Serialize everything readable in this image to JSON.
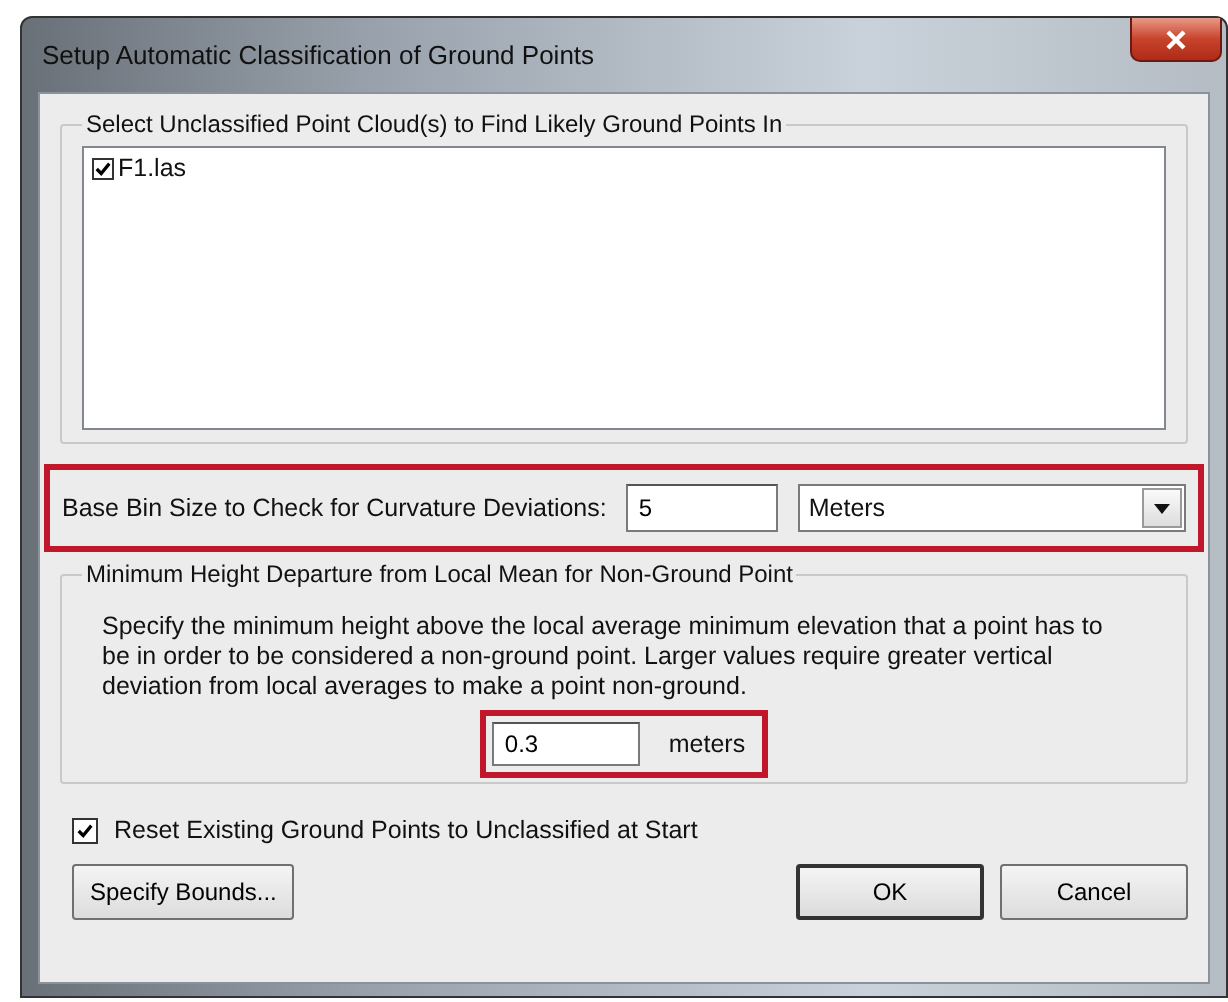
{
  "window": {
    "title": "Setup Automatic Classification of Ground Points"
  },
  "cloud_group": {
    "title": "Select Unclassified Point Cloud(s) to Find Likely Ground Points In",
    "items": [
      {
        "label": "F1.las",
        "checked": true
      }
    ]
  },
  "bin_size": {
    "label": "Base Bin Size to Check for Curvature Deviations:",
    "value": "5",
    "unit": "Meters",
    "highlighted": true
  },
  "height_group": {
    "title": "Minimum Height Departure from Local Mean for Non-Ground Point",
    "description": "Specify the minimum height above the local average minimum elevation that a point has to be in order to be considered a non-ground point. Larger values require greater vertical deviation from local averages to make a point non-ground.",
    "value": "0.3",
    "unit": "meters",
    "highlighted": true
  },
  "reset_option": {
    "label": "Reset Existing Ground Points to Unclassified at Start",
    "checked": true
  },
  "buttons": [
    {
      "label": "Specify Bounds...",
      "kind": "left"
    },
    {
      "label": "OK",
      "kind": "default"
    },
    {
      "label": "Cancel",
      "kind": "normal"
    }
  ]
}
